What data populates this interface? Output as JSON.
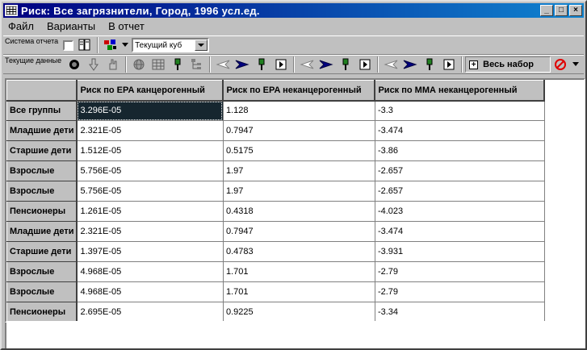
{
  "window": {
    "title": "Риск: Все загрязнители, Город, 1996  усл.ед.",
    "minimize_glyph": "_",
    "maximize_glyph": "□",
    "close_glyph": "×"
  },
  "menu": [
    "Файл",
    "Варианты",
    "В отчет"
  ],
  "toolbar1": {
    "label": "Система отчета",
    "combo_value": "Текущий куб"
  },
  "toolbar2": {
    "label": "Текущие данные",
    "set_label": "Весь набор",
    "set_plus": "+"
  },
  "grid": {
    "columns": [
      "Риск по EPA канцерогенный",
      "Риск по EPA неканцерогенный",
      "Риск по ММА неканцерогенный"
    ],
    "rows": [
      {
        "label": "Все группы",
        "values": [
          "3.296E-05",
          "1.128",
          "-3.3"
        ]
      },
      {
        "label": "Младшие дети",
        "values": [
          "2.321E-05",
          "0.7947",
          "-3.474"
        ]
      },
      {
        "label": "Старшие дети",
        "values": [
          "1.512E-05",
          "0.5175",
          "-3.86"
        ]
      },
      {
        "label": "Взрослые",
        "values": [
          "5.756E-05",
          "1.97",
          "-2.657"
        ]
      },
      {
        "label": "Взрослые",
        "values": [
          "5.756E-05",
          "1.97",
          "-2.657"
        ]
      },
      {
        "label": "Пенсионеры",
        "values": [
          "1.261E-05",
          "0.4318",
          "-4.023"
        ]
      },
      {
        "label": "Младшие дети",
        "values": [
          "2.321E-05",
          "0.7947",
          "-3.474"
        ]
      },
      {
        "label": "Старшие дети",
        "values": [
          "1.397E-05",
          "0.4783",
          "-3.931"
        ]
      },
      {
        "label": "Взрослые",
        "values": [
          "4.968E-05",
          "1.701",
          "-2.79"
        ]
      },
      {
        "label": "Взрослые",
        "values": [
          "4.968E-05",
          "1.701",
          "-2.79"
        ]
      },
      {
        "label": "Пенсионеры",
        "values": [
          "2.695E-05",
          "0.9225",
          "-3.34"
        ]
      }
    ],
    "selected_cell": {
      "row": 0,
      "col": 0
    }
  },
  "colors": {
    "title_start": "#000080",
    "title_end": "#1084d0",
    "selected_cell": "#16262f",
    "face": "#c0c0c0"
  },
  "icons": {
    "app": "grid-app-icon",
    "toolbar1": [
      "book-icon",
      "chart-icon"
    ],
    "toolbar2": [
      "record-icon",
      "hand-pointer-down-icon",
      "hand-icon",
      "globe-icon",
      "table-icon",
      "pin-icon",
      "tree-icon",
      "arrow-left-icon",
      "arrow-right-icon",
      "flag-icon",
      "play-icon",
      "no-entry-icon"
    ]
  }
}
